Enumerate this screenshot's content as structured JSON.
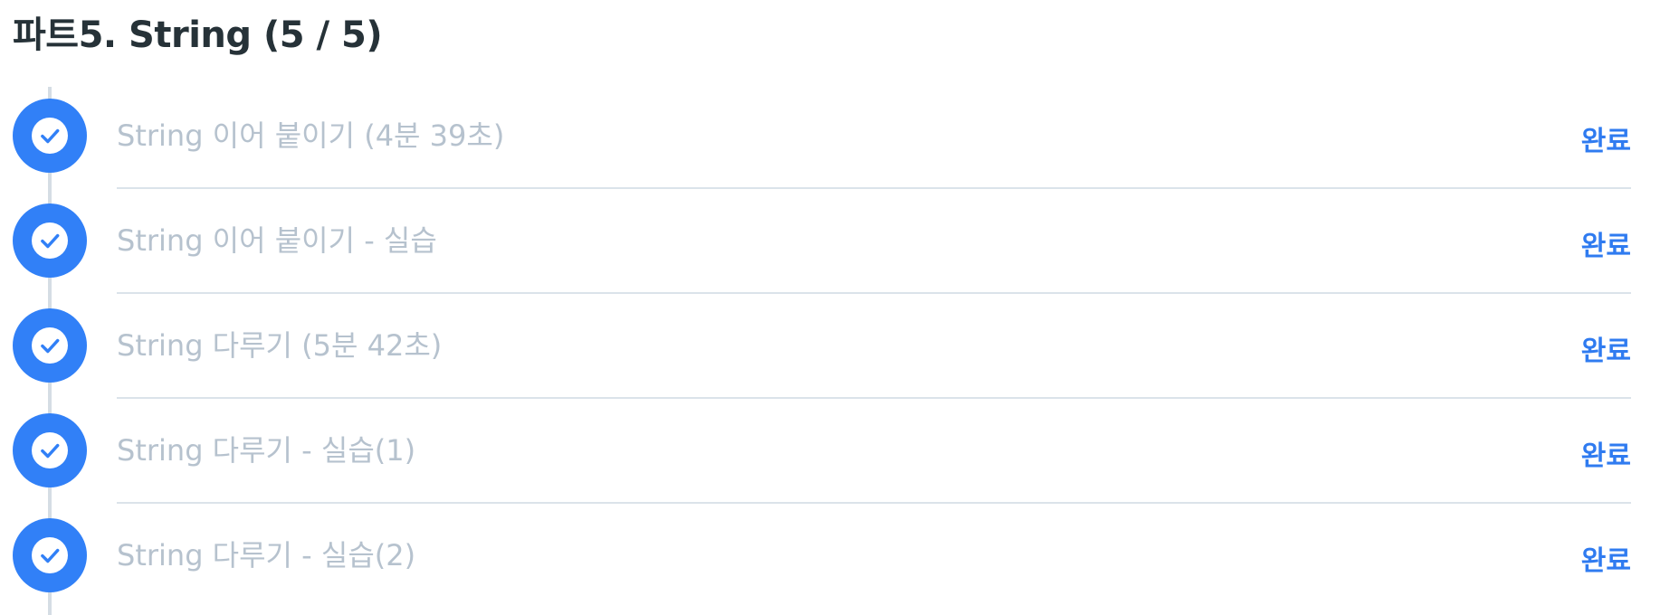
{
  "part": {
    "title": "파트5. String (5 / 5)"
  },
  "colors": {
    "accent": "#3180f7",
    "status_text": "#2f7bf0",
    "lesson_text": "#b6c2ce",
    "title_text": "#263238",
    "divider": "#dbe3ea"
  },
  "lessons": [
    {
      "title": "String 이어 붙이기 (4분 39초)",
      "status": "완료",
      "icon": "check-circle-icon",
      "completed": true
    },
    {
      "title": "String 이어 붙이기 - 실습",
      "status": "완료",
      "icon": "check-circle-icon",
      "completed": true
    },
    {
      "title": "String 다루기 (5분 42초)",
      "status": "완료",
      "icon": "check-circle-icon",
      "completed": true
    },
    {
      "title": "String 다루기 - 실습(1)",
      "status": "완료",
      "icon": "check-circle-icon",
      "completed": true
    },
    {
      "title": "String 다루기 - 실습(2)",
      "status": "완료",
      "icon": "check-circle-icon",
      "completed": true
    }
  ]
}
